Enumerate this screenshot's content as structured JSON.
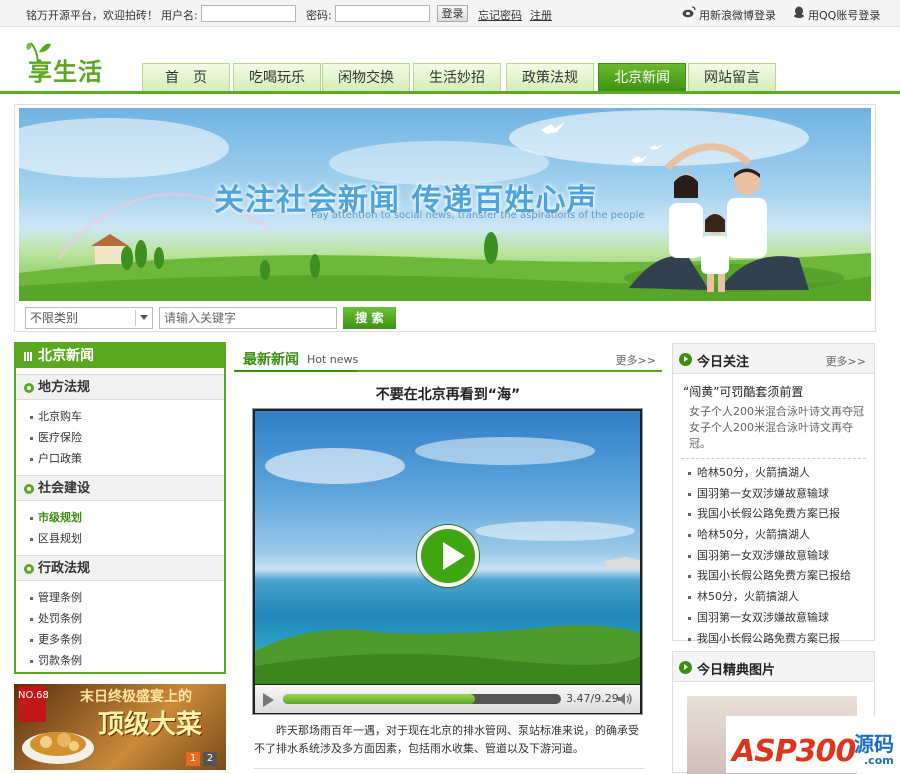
{
  "topbar": {
    "welcome": "铭万开源平台，欢迎拍砖！",
    "username_label": "用户名:",
    "username_value": "",
    "password_label": "密码:",
    "password_value": "",
    "login_button": "登录",
    "forgot_link": "忘记密码",
    "register_link": "注册",
    "weibo_login": "用新浪微博登录",
    "qq_login": "用QQ账号登录"
  },
  "logo": {
    "text": "享生活"
  },
  "nav": {
    "tabs": [
      {
        "label": "首　页",
        "active": false
      },
      {
        "label": "吃喝玩乐",
        "active": false
      },
      {
        "label": "闲物交换",
        "active": false
      },
      {
        "label": "生活妙招",
        "active": false
      },
      {
        "label": "政策法规",
        "active": false
      },
      {
        "label": "北京新闻",
        "active": true
      },
      {
        "label": "网站留言",
        "active": false
      }
    ]
  },
  "banner": {
    "title": "关注社会新闻 传递百姓心声",
    "subtitle": "Pay attention to social news, transfer the aspirations of the people"
  },
  "search": {
    "category_selected": "不限类别",
    "keyword_placeholder": "请输入关键字",
    "button": "搜 索"
  },
  "sidebar": {
    "title": "北京新闻",
    "sections": [
      {
        "title": "地方法规",
        "items": [
          {
            "label": "北京购车",
            "active": false
          },
          {
            "label": "医疗保险",
            "active": false
          },
          {
            "label": "户口政策",
            "active": false
          }
        ]
      },
      {
        "title": "社会建设",
        "items": [
          {
            "label": "市级规划",
            "active": true
          },
          {
            "label": "区县规划",
            "active": false
          }
        ]
      },
      {
        "title": "行政法规",
        "items": [
          {
            "label": "管理条例",
            "active": false
          },
          {
            "label": "处罚条例",
            "active": false
          },
          {
            "label": "更多条例",
            "active": false
          },
          {
            "label": "罚款条例",
            "active": false
          }
        ]
      }
    ]
  },
  "ad": {
    "badge": "NO.68",
    "line1": "末日终极盛宴上的",
    "line2": "顶级大菜",
    "pages": [
      "1",
      "2"
    ]
  },
  "main": {
    "section_title": "最新新闻",
    "section_title_en": "Hot news",
    "more": "更多>>",
    "news_title": "不要在北京再看到“海”",
    "video": {
      "time": "3.47/9.29",
      "progress": 0.69
    },
    "news_body": "昨天那场雨百年一遇，对于现在北京的排水管网、泵站标准来说，的确承受不了排水系统涉及多方面因素，包括雨水收集、管道以及下游河道。"
  },
  "focus": {
    "title": "今日关注",
    "more": "更多>>",
    "lead": "“闯黄”可罚酷套须前置",
    "summary": "女子个人200米混合泳叶诗文再夺冠女子个人200米混合泳叶诗文再夺冠。",
    "items": [
      "哈林50分，火箭搞湖人",
      "国羽第一女双涉嫌故意输球",
      "我国小长假公路免费方案已报",
      "哈林50分，火箭搞湖人",
      "国羽第一女双涉嫌故意输球",
      "我国小长假公路免费方案已报给",
      "林50分，火箭搞湖人",
      "国羽第一女双涉嫌故意输球",
      "我国小长假公路免费方案已报"
    ]
  },
  "photos": {
    "title": "今日精典图片"
  },
  "watermark": {
    "brand": "ASP300",
    "cn": "源码",
    "domain": ".com"
  },
  "colors": {
    "accent": "#5aa820",
    "accent_dark": "#3a8e10",
    "watermark_red": "#e0351c",
    "watermark_blue": "#1b6fc2"
  }
}
